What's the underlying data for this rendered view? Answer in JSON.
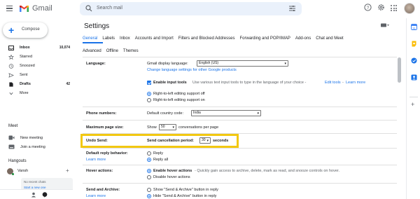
{
  "app": {
    "name": "Gmail",
    "search_placeholder": "Search mail"
  },
  "compose_label": "Compose",
  "sidebar": {
    "items": [
      {
        "label": "Inbox",
        "count": "10,074",
        "icon": "inbox-icon"
      },
      {
        "label": "Starred",
        "count": "",
        "icon": "star-icon"
      },
      {
        "label": "Snoozed",
        "count": "",
        "icon": "clock-icon"
      },
      {
        "label": "Sent",
        "count": "",
        "icon": "send-icon"
      },
      {
        "label": "Drafts",
        "count": "42",
        "icon": "draft-icon"
      },
      {
        "label": "More",
        "count": "",
        "icon": "chevron-down-icon"
      }
    ],
    "meet": {
      "heading": "Meet",
      "new_meeting": "New meeting",
      "join_meeting": "Join a meeting"
    },
    "hangouts": {
      "heading": "Hangouts",
      "user": "Vansh",
      "no_chats": "No recent chats",
      "start_new": "Start a new one"
    }
  },
  "settings": {
    "title": "Settings",
    "tabs_row1": [
      "General",
      "Labels",
      "Inbox",
      "Accounts and Import",
      "Filters and Blocked Addresses",
      "Forwarding and POP/IMAP",
      "Add-ons",
      "Chat and Meet"
    ],
    "tabs_row2": [
      "Advanced",
      "Offline",
      "Themes"
    ],
    "language": {
      "label": "Language:",
      "display_label": "Gmail display language:",
      "display_value": "English (US)",
      "change_link": "Change language settings for other Google products",
      "input_tools_label": "Enable input tools",
      "input_tools_desc": "Use various text input tools to type in the language of your choice -",
      "edit_tools_link": "Edit tools",
      "learn_more": "Learn more",
      "rtl_off": "Right-to-left editing support off",
      "rtl_on": "Right-to-left editing support on"
    },
    "phone": {
      "label": "Phone numbers:",
      "country_label": "Default country code:",
      "country_value": "India"
    },
    "page_size": {
      "label": "Maximum page size:",
      "show": "Show",
      "value": "50",
      "suffix": "conversations per page"
    },
    "undo_send": {
      "label": "Undo Send:",
      "period_label": "Send cancellation period:",
      "value": "30",
      "suffix": "seconds"
    },
    "reply": {
      "label": "Default reply behavior:",
      "learn_more": "Learn more",
      "opt1": "Reply",
      "opt2": "Reply all"
    },
    "hover": {
      "label": "Hover actions:",
      "opt1_bold": "Enable hover actions",
      "opt1_rest": "- Quickly gain access to archive, delete, mark as read, and snooze controls on hover.",
      "opt2": "Disable hover actions"
    },
    "send_archive": {
      "label": "Send and Archive:",
      "learn_more": "Learn more",
      "opt1": "Show \"Send & Archive\" button in reply",
      "opt2": "Hide \"Send & Archive\" button in reply"
    }
  },
  "colors": {
    "accent": "#1a73e8",
    "highlight": "#f2c811"
  }
}
